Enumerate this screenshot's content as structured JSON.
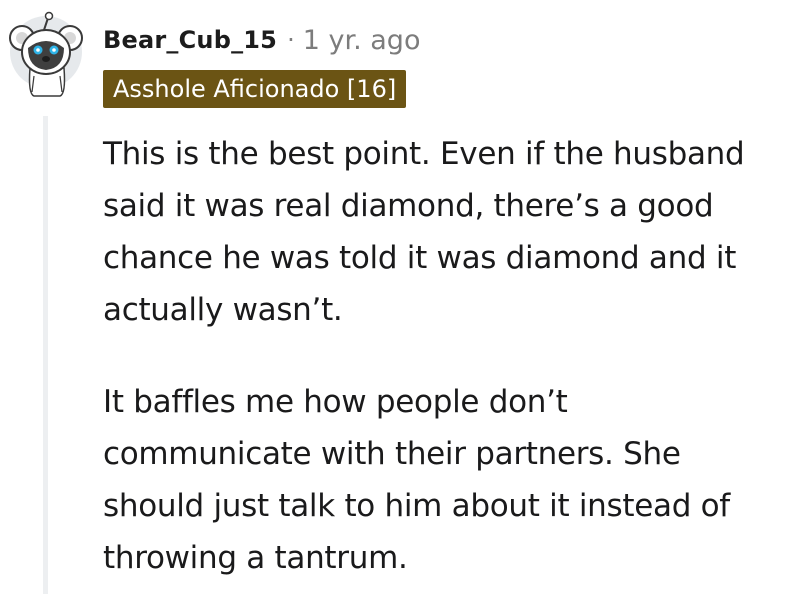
{
  "comment": {
    "username": "Bear_Cub_15",
    "separator": "·",
    "timestamp": "1 yr. ago",
    "flair": "Asshole Aficionado [16]",
    "avatar_icon": "koala-avatar-icon",
    "paragraphs": [
      "This is the best point. Even if the husband said it was real diamond, there’s a good chance he was told it was diamond and it actually wasn’t.",
      "It baffles me how people don’t communicate with their partners. She should just talk to him about it instead of throwing a tantrum."
    ]
  },
  "colors": {
    "flair_background": "#6b5414",
    "flair_text": "#ffffff",
    "meta_text": "#7c7c7c",
    "thread_line": "#edeff1"
  }
}
